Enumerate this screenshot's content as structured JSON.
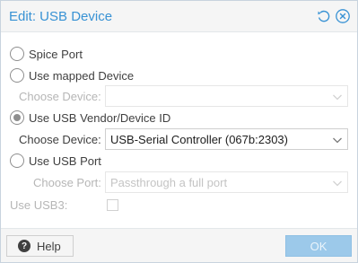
{
  "dialog": {
    "title": "Edit: USB Device",
    "icons": {
      "reset": "reset-icon",
      "close": "close-icon"
    }
  },
  "options": {
    "spice_port": {
      "label": "Spice Port",
      "checked": false
    },
    "mapped_device": {
      "label": "Use mapped Device",
      "checked": false
    },
    "vendor_id": {
      "label": "Use USB Vendor/Device ID",
      "checked": true
    },
    "usb_port": {
      "label": "Use USB Port",
      "checked": false
    }
  },
  "mapped": {
    "label": "Choose Device:",
    "value": ""
  },
  "vendor": {
    "label": "Choose Device:",
    "value": "USB-Serial Controller (067b:2303)"
  },
  "port": {
    "label": "Choose Port:",
    "placeholder": "Passthrough a full port"
  },
  "usb3": {
    "label": "Use USB3:",
    "checked": false
  },
  "footer": {
    "help_label": "Help",
    "ok_label": "OK"
  },
  "colors": {
    "accent": "#3892d4",
    "ok_disabled": "#9cc9ea"
  }
}
